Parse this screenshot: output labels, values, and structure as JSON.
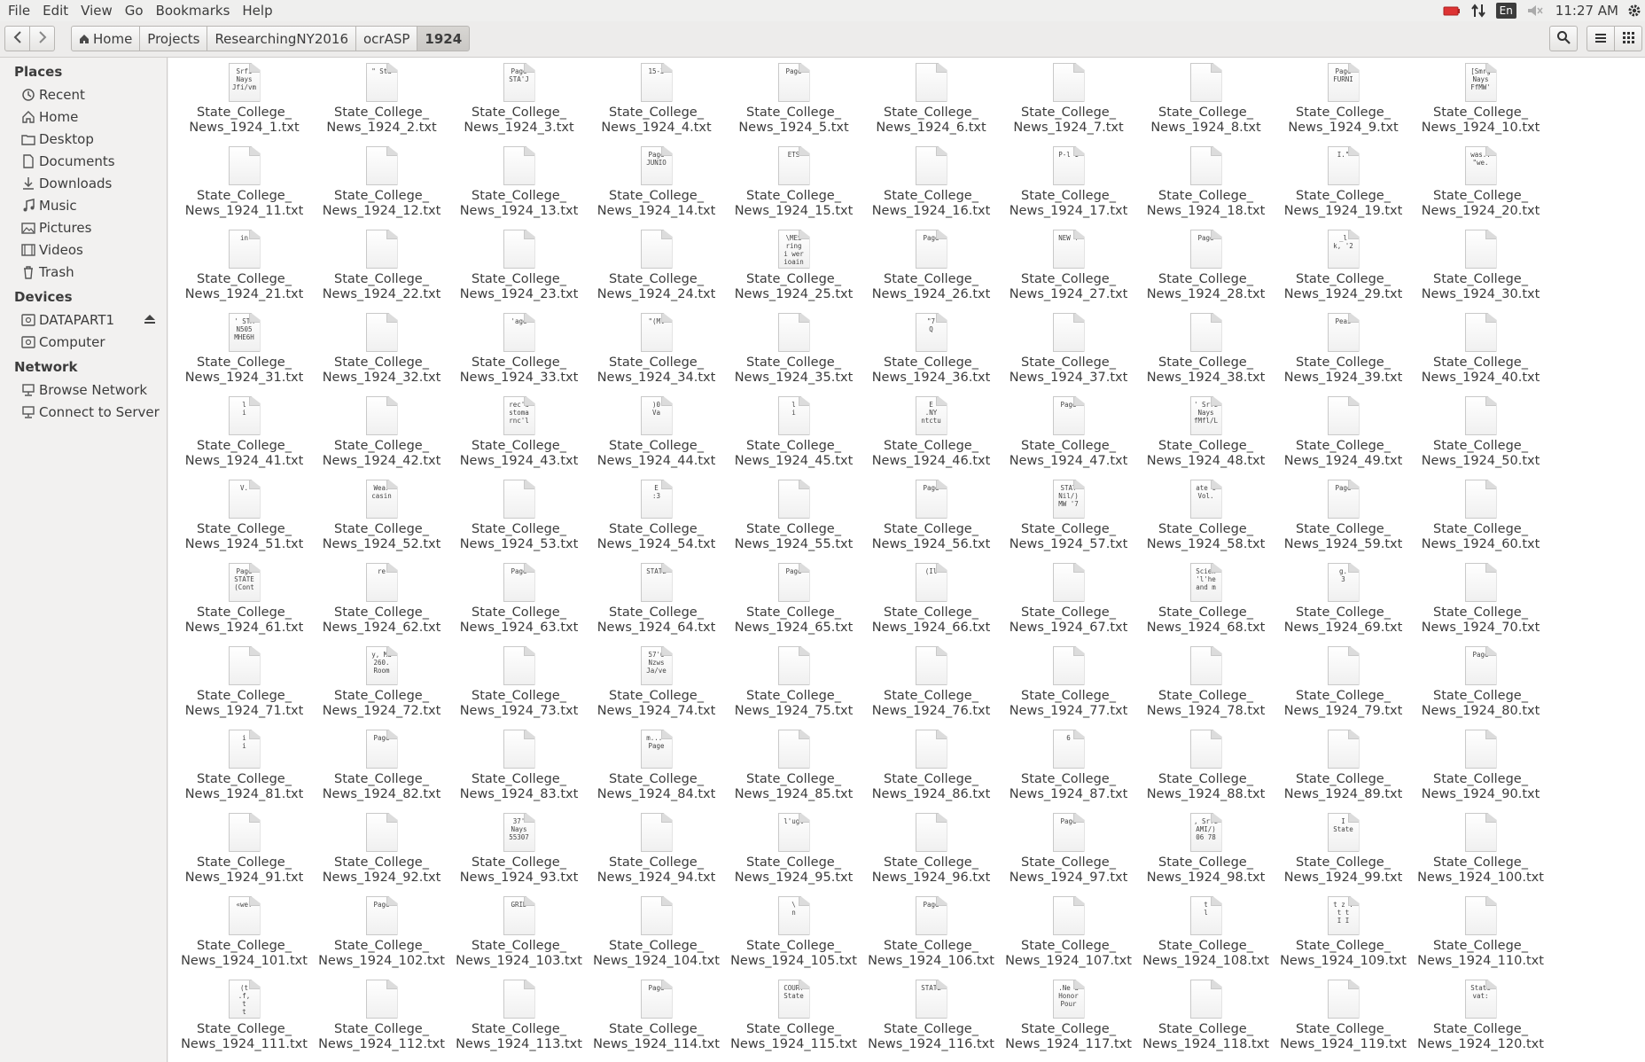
{
  "menubar": {
    "items": [
      "File",
      "Edit",
      "View",
      "Go",
      "Bookmarks",
      "Help"
    ],
    "tray": {
      "battery_icon": "battery-icon",
      "network_icon": "network-arrows-icon",
      "language": "En",
      "volume_icon": "volume-muted-icon",
      "clock": "11:27 AM",
      "settings_icon": "gear-icon"
    }
  },
  "toolbar": {
    "back_icon": "chevron-left-icon",
    "forward_icon": "chevron-right-icon",
    "breadcrumb": [
      "Home",
      "Projects",
      "ResearchingNY2016",
      "ocrASP",
      "1924"
    ],
    "search_icon": "search-icon",
    "list_view_icon": "list-view-icon",
    "grid_view_icon": "grid-view-icon"
  },
  "sidebar": {
    "places_header": "Places",
    "places": [
      {
        "label": "Recent",
        "icon": "clock-icon"
      },
      {
        "label": "Home",
        "icon": "home-icon"
      },
      {
        "label": "Desktop",
        "icon": "folder-icon"
      },
      {
        "label": "Documents",
        "icon": "document-icon"
      },
      {
        "label": "Downloads",
        "icon": "download-icon"
      },
      {
        "label": "Music",
        "icon": "music-icon"
      },
      {
        "label": "Pictures",
        "icon": "picture-icon"
      },
      {
        "label": "Videos",
        "icon": "video-icon"
      },
      {
        "label": "Trash",
        "icon": "trash-icon"
      }
    ],
    "devices_header": "Devices",
    "devices": [
      {
        "label": "DATAPART1",
        "icon": "drive-icon",
        "eject": true
      },
      {
        "label": "Computer",
        "icon": "drive-icon"
      }
    ],
    "network_header": "Network",
    "network": [
      {
        "label": "Browse Network",
        "icon": "network-icon"
      },
      {
        "label": "Connect to Server",
        "icon": "server-icon"
      }
    ]
  },
  "files": {
    "name_prefix": "State_College_",
    "name_line2": "News_1924_{n}.txt",
    "count": 120,
    "previews": {
      "1": "Srfi\nNays\nJfi/vm",
      "2": "\" Sta",
      "3": "Page\nSTA'J",
      "4": "15-3",
      "5": "Page",
      "9": "Page\nFURNI",
      "10": "[Smrg\nNays\nFfMW'",
      "14": "Page\nJUNIO",
      "15": "ETS",
      "17": "P-l 1",
      "19": "I.\"",
      "20": "was..\n\"we.",
      "21": "in",
      "25": "\\MES\nring\ni wer\nioain",
      "26": "Page",
      "27": "NEW Y",
      "28": "Page",
      "29": "_l\nk, '2",
      "31": "' STA\nN505\nMHE6H",
      "33": "'age",
      "34": "\"(Ml",
      "36": "\"7\nQ",
      "39": "Peas",
      "41": "l\ni",
      "43": "rec'd\nstoma\nrnc'l",
      "44": ")0\nVa",
      "45": "l\ni",
      "46": "E\n.NY\nntctu",
      "47": "Page",
      "48": "' Srfi\nNays\nfMfl/L",
      "51": "V.",
      "52": "Wear\ncasin",
      "54": "E\n:3",
      "56": "Page",
      "57": "STAT\nNil/)\nMW '7",
      "58": "ate C\nVol.",
      "59": "Page",
      "61": "Page\nSTATE\n(Cont",
      "62": "re",
      "63": "Page",
      "64": "STATE",
      "65": "Page",
      "66": "(Il",
      "68": "Scien\n'l'he\nand m",
      "69": "g.\n3",
      "72": "y, Ma\n260.\nRoom",
      "74": "57'6\nNzws\nJa/ve",
      "80": "Page",
      "81": "i\ni",
      "82": "Page",
      "84": "m...-\nPage",
      "87": "6",
      "93": "37'\nNays\n55307",
      "95": "l'ugt",
      "97": "Page",
      "98": ", Srfi\nAMI/)\n06 78",
      "99": "I\nState",
      "101": "«we?",
      "102": "Page",
      "103": "GRID",
      "105": "\\\nn",
      "106": "Page",
      "108": "t\nl",
      "109": "t z .\nt t\nI I",
      "111": "(t\n.f,\nt\nt",
      "114": "Page",
      "115": "COURT\nState",
      "116": "STATE",
      "117": ".Ne a\nHonor\nPour",
      "120": "State\nvat:"
    }
  },
  "colors": {
    "sidebar_bg": "#f2f1f0",
    "content_bg": "#ffffff",
    "text": "#3c3c3c"
  }
}
